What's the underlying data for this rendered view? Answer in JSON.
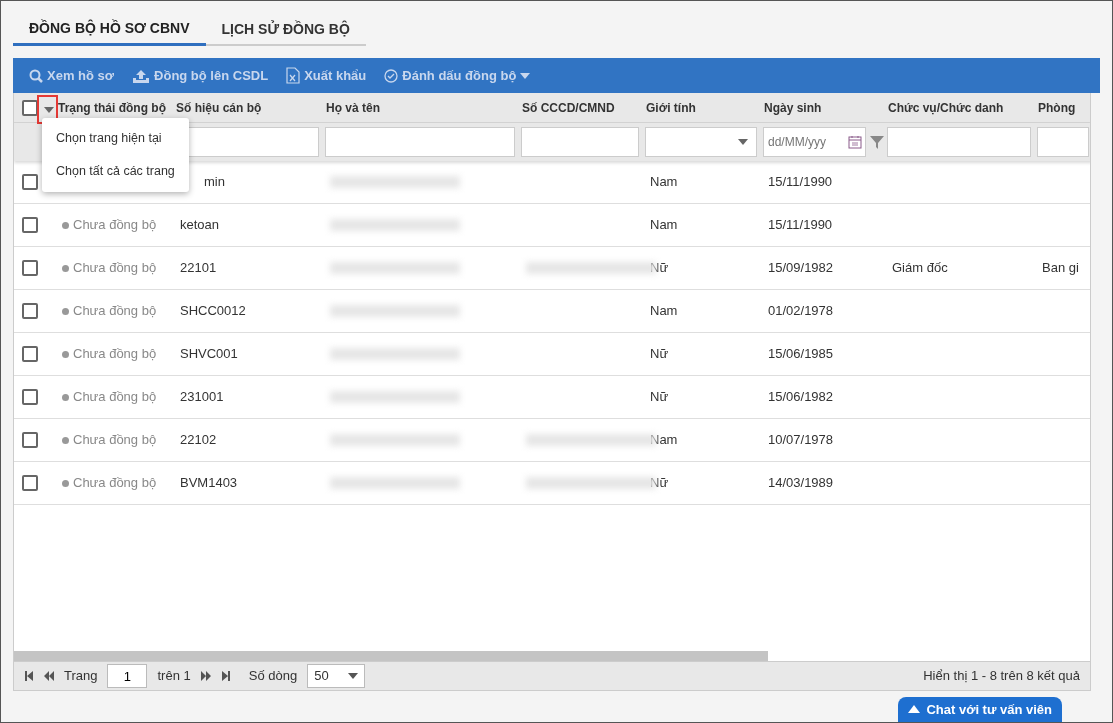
{
  "tabs": [
    {
      "label": "ĐỒNG BỘ HỒ SƠ CBNV",
      "selected": true
    },
    {
      "label": "LỊCH SỬ ĐỒNG BỘ",
      "selected": false
    }
  ],
  "toolbar": [
    {
      "kind": "search",
      "label": "Xem hồ sơ"
    },
    {
      "kind": "upload",
      "label": "Đồng bộ lên CSDL"
    },
    {
      "kind": "excel",
      "label": "Xuất khẩu"
    },
    {
      "kind": "mark",
      "label": "Đánh dấu đồng bộ",
      "dropdown": true
    }
  ],
  "table": {
    "select_all_checked": false,
    "columns": [
      {
        "label": "Trạng thái đồng bộ"
      },
      {
        "label": "Số hiệu cán bộ"
      },
      {
        "label": "Họ và tên"
      },
      {
        "label": "Số CCCD/CMND"
      },
      {
        "label": "Giới tính"
      },
      {
        "label": "Ngày sinh"
      },
      {
        "label": "Chức vụ/Chức danh"
      },
      {
        "label": "Phòng"
      }
    ],
    "filters": [
      {
        "kind": "none"
      },
      {
        "kind": "text"
      },
      {
        "kind": "text"
      },
      {
        "kind": "text"
      },
      {
        "kind": "select"
      },
      {
        "kind": "date",
        "placeholder": "dd/MM/yyy"
      },
      {
        "kind": "text"
      },
      {
        "kind": "text"
      }
    ],
    "rows": [
      {
        "checked": false,
        "cells": [
          {
            "kind": "empty"
          },
          {
            "kind": "covered_text",
            "text": "min"
          },
          {
            "kind": "blurred"
          },
          {
            "kind": "empty"
          },
          {
            "kind": "text",
            "text": "Nam"
          },
          {
            "kind": "text",
            "text": "15/11/1990"
          },
          {
            "kind": "empty"
          },
          {
            "kind": "empty"
          }
        ]
      },
      {
        "checked": false,
        "cells": [
          {
            "kind": "status",
            "text": "Chưa đồng bộ"
          },
          {
            "kind": "text",
            "text": "ketoan"
          },
          {
            "kind": "blurred"
          },
          {
            "kind": "empty"
          },
          {
            "kind": "text",
            "text": "Nam"
          },
          {
            "kind": "text",
            "text": "15/11/1990"
          },
          {
            "kind": "empty"
          },
          {
            "kind": "empty"
          }
        ]
      },
      {
        "checked": false,
        "cells": [
          {
            "kind": "status",
            "text": "Chưa đồng bộ"
          },
          {
            "kind": "text",
            "text": "22101"
          },
          {
            "kind": "blurred"
          },
          {
            "kind": "blurred"
          },
          {
            "kind": "text",
            "text": "Nữ"
          },
          {
            "kind": "text",
            "text": "15/09/1982"
          },
          {
            "kind": "text",
            "text": "Giám đốc"
          },
          {
            "kind": "text",
            "text": "Ban gi"
          }
        ]
      },
      {
        "checked": false,
        "cells": [
          {
            "kind": "status",
            "text": "Chưa đồng bộ"
          },
          {
            "kind": "text",
            "text": "SHCC0012"
          },
          {
            "kind": "blurred"
          },
          {
            "kind": "empty"
          },
          {
            "kind": "text",
            "text": "Nam"
          },
          {
            "kind": "text",
            "text": "01/02/1978"
          },
          {
            "kind": "empty"
          },
          {
            "kind": "empty"
          }
        ]
      },
      {
        "checked": false,
        "cells": [
          {
            "kind": "status",
            "text": "Chưa đồng bộ"
          },
          {
            "kind": "text",
            "text": "SHVC001"
          },
          {
            "kind": "blurred"
          },
          {
            "kind": "empty"
          },
          {
            "kind": "text",
            "text": "Nữ"
          },
          {
            "kind": "text",
            "text": "15/06/1985"
          },
          {
            "kind": "empty"
          },
          {
            "kind": "empty"
          }
        ]
      },
      {
        "checked": false,
        "cells": [
          {
            "kind": "status",
            "text": "Chưa đồng bộ"
          },
          {
            "kind": "text",
            "text": "231001"
          },
          {
            "kind": "blurred"
          },
          {
            "kind": "empty"
          },
          {
            "kind": "text",
            "text": "Nữ"
          },
          {
            "kind": "text",
            "text": "15/06/1982"
          },
          {
            "kind": "empty"
          },
          {
            "kind": "empty"
          }
        ]
      },
      {
        "checked": false,
        "cells": [
          {
            "kind": "status",
            "text": "Chưa đồng bộ"
          },
          {
            "kind": "text",
            "text": "22102"
          },
          {
            "kind": "blurred"
          },
          {
            "kind": "blurred"
          },
          {
            "kind": "text",
            "text": "Nam"
          },
          {
            "kind": "text",
            "text": "10/07/1978"
          },
          {
            "kind": "empty"
          },
          {
            "kind": "empty"
          }
        ]
      },
      {
        "checked": false,
        "cells": [
          {
            "kind": "status",
            "text": "Chưa đồng bộ"
          },
          {
            "kind": "text",
            "text": "BVM1403"
          },
          {
            "kind": "blurred"
          },
          {
            "kind": "blurred"
          },
          {
            "kind": "text",
            "text": "Nữ"
          },
          {
            "kind": "text",
            "text": "14/03/1989"
          },
          {
            "kind": "empty"
          },
          {
            "kind": "empty"
          }
        ]
      }
    ]
  },
  "select_menu": [
    "Chọn trang hiện tại",
    "Chọn tất cả các trang"
  ],
  "pager": {
    "page_label": "Trang",
    "page": "1",
    "of_label": "trên 1",
    "rows_label": "Số dòng",
    "rows_value": "50",
    "summary": "Hiển thị 1 - 8 trên 8 kết quả"
  },
  "chat_button": "Chat với tư vấn viên"
}
